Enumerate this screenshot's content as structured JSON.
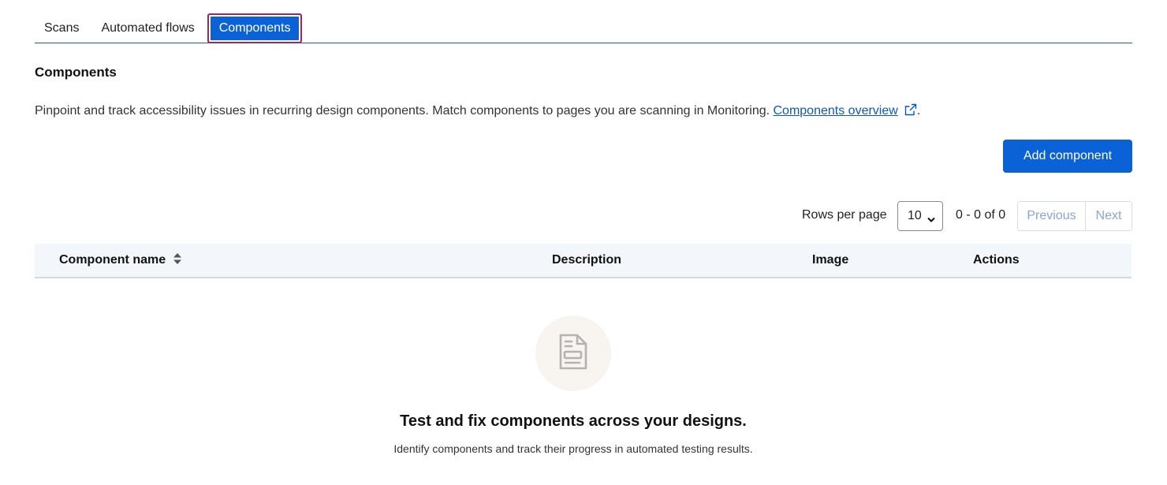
{
  "tabs": [
    {
      "label": "Scans"
    },
    {
      "label": "Automated flows"
    },
    {
      "label": "Components",
      "active": true
    }
  ],
  "section": {
    "title": "Components",
    "description": "Pinpoint and track accessibility issues in recurring design components. Match components to pages you are scanning in Monitoring.",
    "link_label": "Components overview",
    "link_suffix": "."
  },
  "actions": {
    "add_label": "Add component"
  },
  "pagination": {
    "rows_label": "Rows per page",
    "rows_value": "10",
    "range": "0 - 0 of 0",
    "prev_label": "Previous",
    "next_label": "Next"
  },
  "table": {
    "columns": [
      "Component name",
      "Description",
      "Image",
      "Actions"
    ]
  },
  "empty_state": {
    "title": "Test and fix components across your designs.",
    "subtitle": "Identify components and track their progress in automated testing results.",
    "icon": "document-icon"
  },
  "colors": {
    "primary": "#0b62d6",
    "focus_ring": "#a0207a",
    "link": "#0b58c4",
    "table_header_bg": "#f3f7fc"
  }
}
